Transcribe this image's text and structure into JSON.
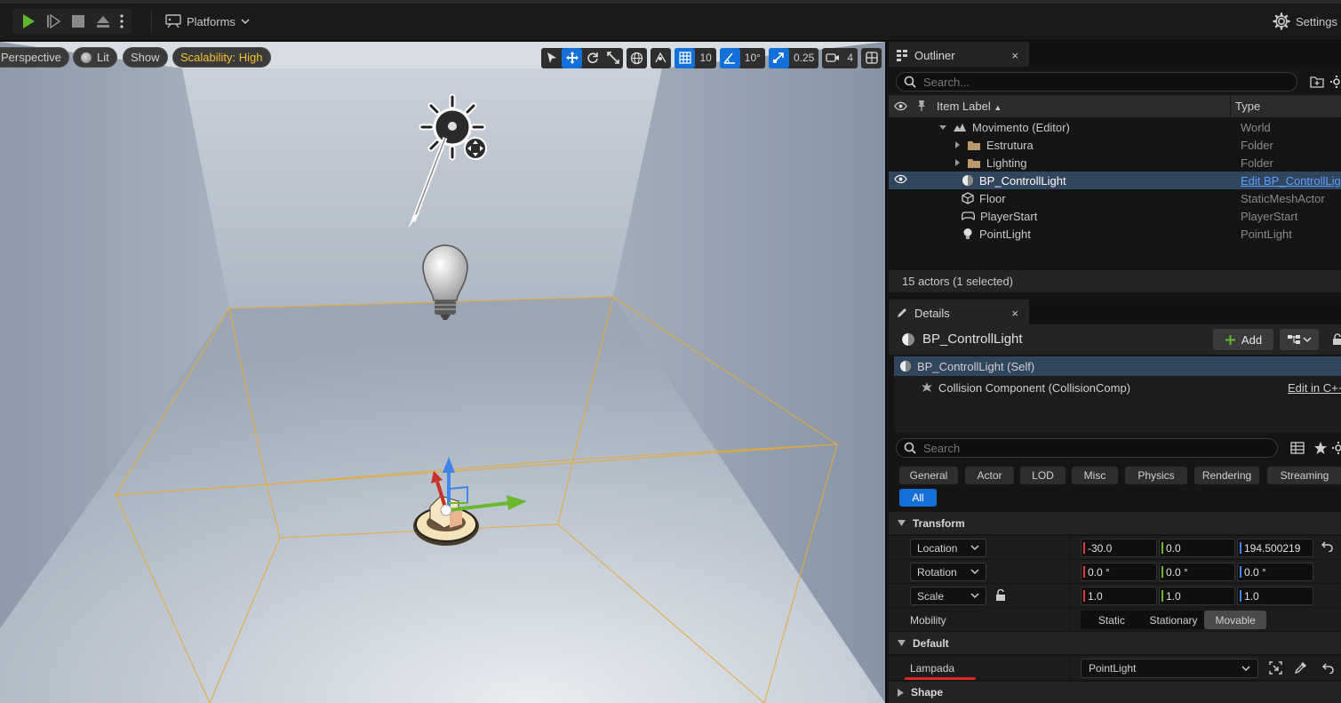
{
  "toolbar": {
    "platforms_label": "Platforms",
    "settings_label": "Settings"
  },
  "viewport": {
    "perspective_label": "Perspective",
    "lit_label": "Lit",
    "show_label": "Show",
    "scalability_label": "Scalability: High",
    "grid_snap_value": "10",
    "rotation_snap_value": "10°",
    "scale_snap_value": "0.25",
    "camera_speed_value": "4"
  },
  "outliner": {
    "tab_label": "Outliner",
    "close": "×",
    "search_placeholder": "Search...",
    "col_label": "Item Label",
    "sort_arrow": "▲",
    "col_type": "Type",
    "rows": [
      {
        "label": "Movimento (Editor)",
        "type": "World"
      },
      {
        "label": "Estrutura",
        "type": "Folder"
      },
      {
        "label": "Lighting",
        "type": "Folder"
      },
      {
        "label": "BP_ControllLight",
        "type": "Edit BP_ControllLight"
      },
      {
        "label": "Floor",
        "type": "StaticMeshActor"
      },
      {
        "label": "PlayerStart",
        "type": "PlayerStart"
      },
      {
        "label": "PointLight",
        "type": "PointLight"
      }
    ],
    "status": "15 actors (1 selected)"
  },
  "details": {
    "tab_label": "Details",
    "close": "×",
    "actor_name": "BP_ControllLight",
    "add_label": "Add",
    "components": [
      {
        "label": "BP_ControllLight (Self)",
        "edit": ""
      },
      {
        "label": "Collision Component (CollisionComp)",
        "edit": "Edit in C++"
      }
    ],
    "search_placeholder": "Search",
    "categories": [
      "General",
      "Actor",
      "LOD",
      "Misc",
      "Physics",
      "Rendering",
      "Streaming",
      "All"
    ],
    "transform_section": "Transform",
    "location_label": "Location",
    "location": [
      "-30.0",
      "0.0",
      "194.500219"
    ],
    "rotation_label": "Rotation",
    "rotation": [
      "0.0 °",
      "0.0 °",
      "0.0 °"
    ],
    "scale_label": "Scale",
    "scale": [
      "1.0",
      "1.0",
      "1.0"
    ],
    "mobility_label": "Mobility",
    "mobility_options": [
      "Static",
      "Stationary",
      "Movable"
    ],
    "mobility_selected": "Movable",
    "default_section": "Default",
    "lampada_label": "Lampada",
    "lampada_value": "PointLight",
    "shape_section": "Shape"
  },
  "colors": {
    "accent": "#1470d9",
    "selection": "#31455c",
    "x_axis": "#e03b3b",
    "y_axis": "#6ab82e",
    "z_axis": "#3f86e8",
    "bounds": "#e8a93a",
    "annotation_underline": "#d8282a"
  }
}
